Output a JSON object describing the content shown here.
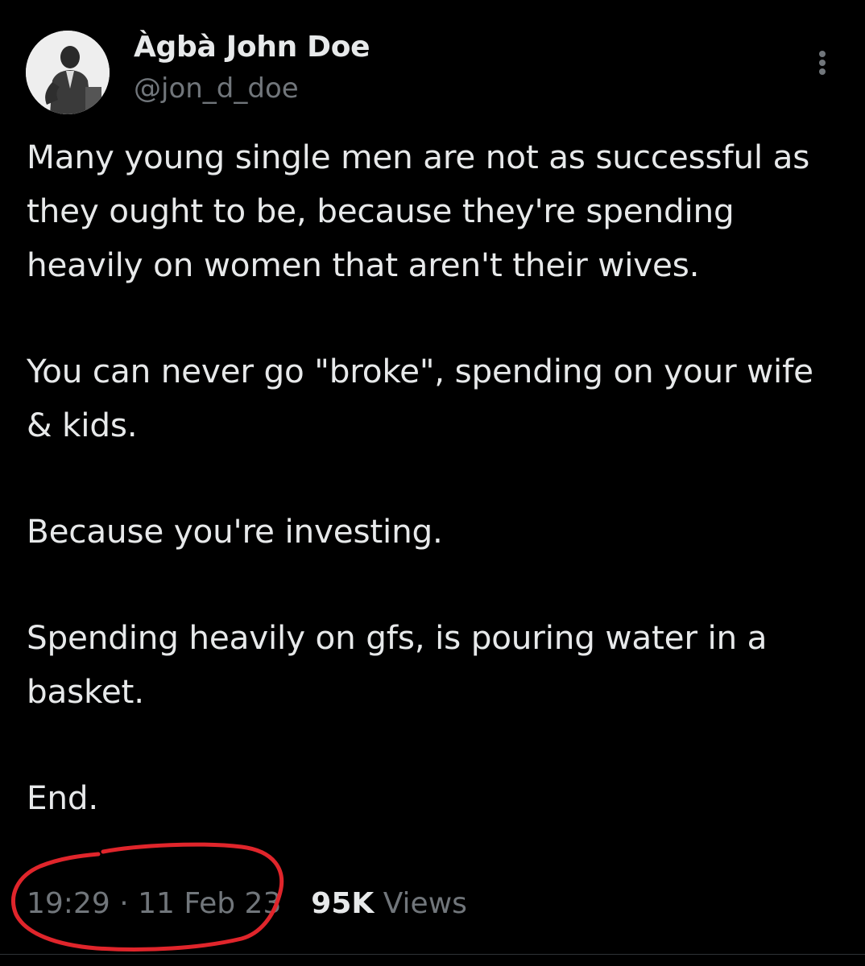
{
  "tweet": {
    "author": {
      "display_name": "Àgbà John Doe",
      "handle": "@jon_d_doe"
    },
    "paragraphs": [
      "Many young single men are not as successful as they ought to be, because they're spending heavily on women that aren't their wives.",
      "You can never go \"broke\", spending on your wife & kids.",
      "Because you're investing.",
      "Spending heavily on gfs, is pouring water in a basket.",
      "End."
    ],
    "time": "19:29",
    "separator": "·",
    "date": "11 Feb 23",
    "views_count": "95K",
    "views_label": "Views"
  },
  "icons": {
    "more": "more-dots-icon",
    "annotation": "red-circle-annotation"
  },
  "colors": {
    "background": "#000000",
    "primary_text": "#e7e9ea",
    "secondary_text": "#71767b",
    "annotation": "#e0252b"
  }
}
